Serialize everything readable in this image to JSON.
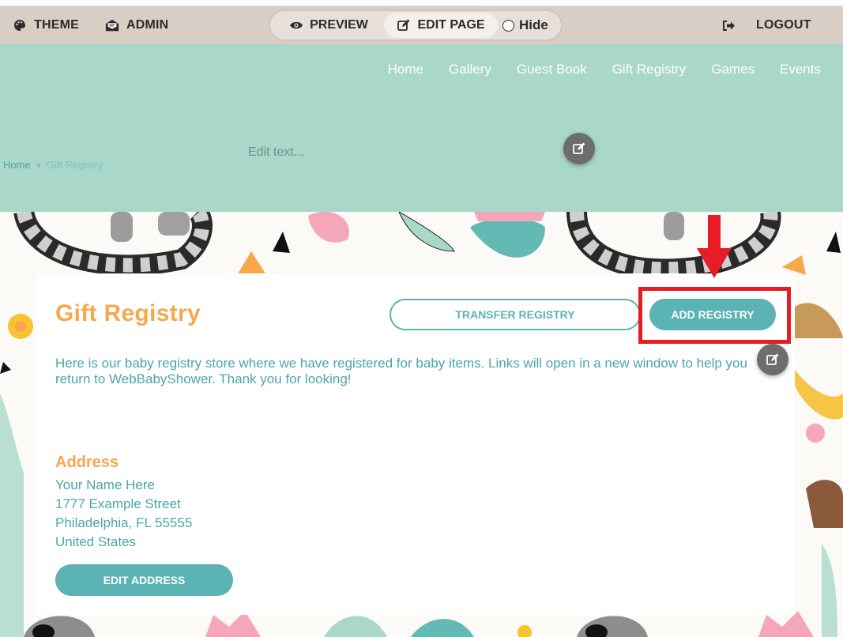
{
  "toolbar": {
    "theme_label": "THEME",
    "admin_label": "ADMIN",
    "preview_label": "PREVIEW",
    "edit_page_label": "EDIT PAGE",
    "hide_label": "Hide",
    "logout_label": "LOGOUT"
  },
  "nav": {
    "items": [
      "Home",
      "Gallery",
      "Guest Book",
      "Gift Registry",
      "Games",
      "Events"
    ]
  },
  "hero": {
    "edit_placeholder": "Edit text..."
  },
  "breadcrumb": {
    "home": "Home",
    "separator": "›",
    "current": "Gift Registry"
  },
  "registry": {
    "title": "Gift Registry",
    "transfer_button": "TRANSFER REGISTRY",
    "add_button": "ADD REGISTRY",
    "intro": "Here is our baby registry store where we have registered for baby items. Links will open in a new window to help you return to WebBabyShower. Thank you for looking!"
  },
  "address": {
    "heading": "Address",
    "lines": [
      "Your Name Here",
      "1777 Example Street",
      "Philadelphia, FL 55555",
      "United States"
    ],
    "edit_button": "EDIT ADDRESS"
  },
  "colors": {
    "toolbar_bg": "#d8cec6",
    "hero_bg": "#a9d7ca",
    "accent_teal": "#5bb3b3",
    "accent_orange": "#f5a94e",
    "highlight_red": "#e81c24"
  },
  "icons": {
    "theme": "palette-icon",
    "admin": "envelope-open-icon",
    "preview": "eye-icon",
    "edit_page": "edit-icon",
    "logout": "sign-out-icon",
    "edit_bubble": "edit-icon",
    "annotation": "arrow-down-icon"
  }
}
